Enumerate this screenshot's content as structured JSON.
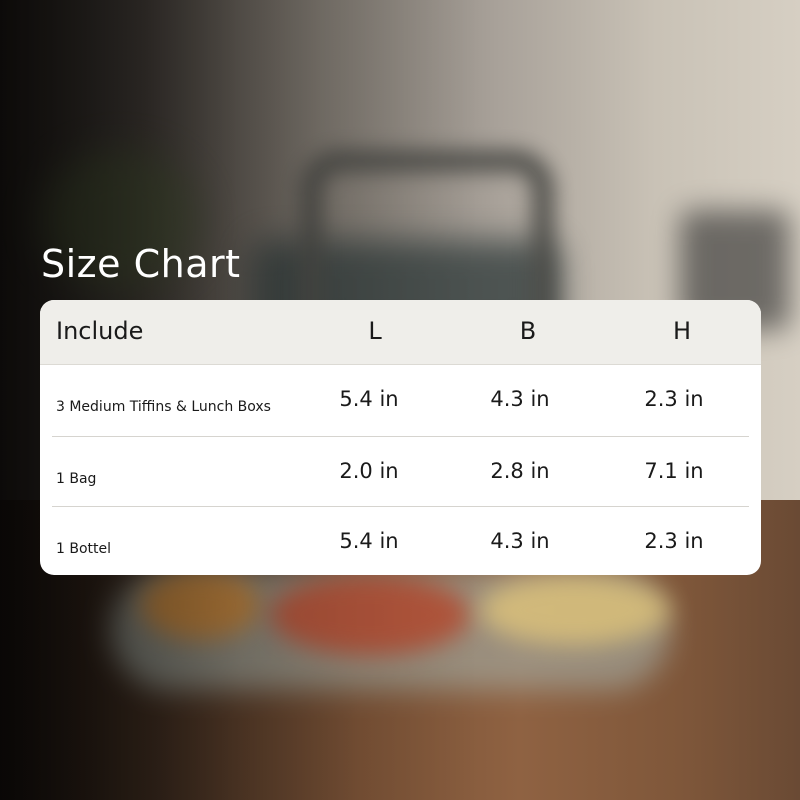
{
  "title": "Size Chart",
  "table": {
    "headers": [
      "Include",
      "L",
      "B",
      "H"
    ],
    "rows": [
      {
        "include": "3 Medium Tiffins & Lunch Boxs",
        "l": "5.4 in",
        "b": "4.3 in",
        "h": "2.3 in"
      },
      {
        "include": "1 Bag",
        "l": "2.0 in",
        "b": "2.8 in",
        "h": "7.1 in"
      },
      {
        "include": "1 Bottel",
        "l": "5.4 in",
        "b": "4.3 in",
        "h": "2.3 in"
      }
    ]
  },
  "colors": {
    "header_bg": "#efeeea",
    "card_bg": "#ffffff",
    "title_text": "#ffffff",
    "cell_text": "#1a1a1a"
  }
}
